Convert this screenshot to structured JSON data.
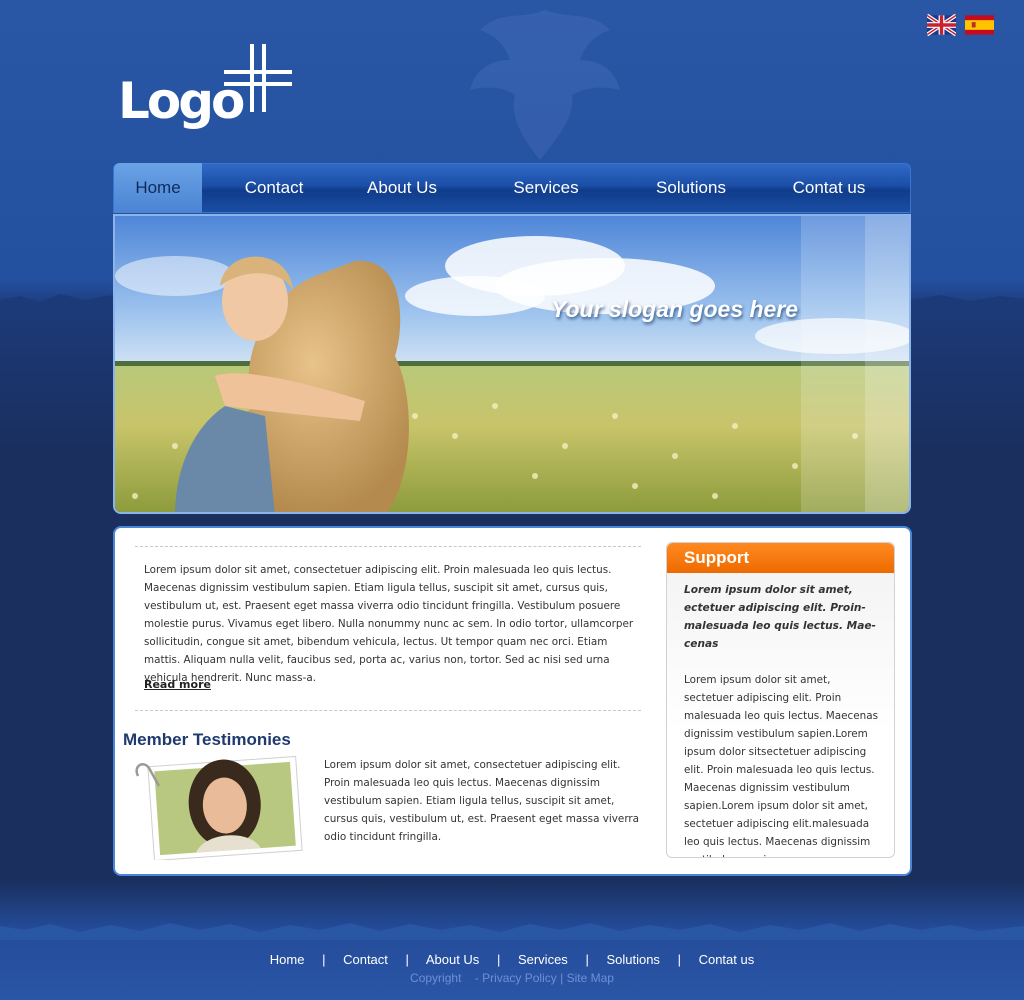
{
  "header": {
    "logo_text": "Logo",
    "flags": [
      {
        "icon": "uk-flag-icon",
        "language": "English"
      },
      {
        "icon": "spain-flag-icon",
        "language": "Spanish"
      }
    ]
  },
  "nav": {
    "items": [
      {
        "label": "Home",
        "active": true
      },
      {
        "label": "Contact"
      },
      {
        "label": "About Us"
      },
      {
        "label": "Services"
      },
      {
        "label": "Solutions"
      },
      {
        "label": "Contat us"
      }
    ]
  },
  "banner": {
    "slogan": "Your slogan goes here"
  },
  "main": {
    "intro_text": "Lorem ipsum dolor sit amet, consectetuer adipiscing elit. Proin malesuada leo quis lectus. Maecenas dignissim vestibulum sapien. Etiam ligula tellus, suscipit sit amet, cursus quis, vestibulum ut, est. Praesent eget massa viverra odio tincidunt fringilla. Vestibulum posuere molestie purus. Vivamus eget libero. Nulla nonummy nunc ac sem. In odio tortor, ullamcorper sollicitudin, congue sit amet, bibendum vehicula, lectus. Ut tempor quam nec orci. Etiam mattis. Aliquam nulla velit, faucibus sed, porta ac, varius non, tortor. Sed ac nisi sed urna vehicula hendrerit. Nunc mass-a.",
    "read_more": "Read more",
    "testimonies_title": "Member Testimonies",
    "testimony_text": "Lorem ipsum dolor sit amet, consectetuer adipiscing elit. Proin malesuada leo quis lectus. Maecenas dignissim vestibulum sapien. Etiam ligula tellus, suscipit sit amet, cursus quis, vestibulum ut, est. Praesent eget massa viverra odio tincidunt fringilla."
  },
  "support": {
    "title": "Support",
    "lead": "Lorem ipsum dolor sit amet, ectetuer adipiscing elit. Proin- malesuada leo quis lectus. Mae- cenas",
    "body": "Lorem ipsum dolor sit amet, sectetuer adipiscing elit. Proin malesuada leo quis lectus. Maecenas dignissim vestibulum sapien.Lorem ipsum dolor sitsectetuer adipiscing elit. Proin malesuada leo quis lectus. Maecenas dignissim vestibulum sapien.Lorem ipsum dolor sit amet, sectetuer adipiscing elit.malesuada leo quis lectus. Maecenas dignissim vestibulum sapien."
  },
  "footer": {
    "links": [
      "Home",
      "Contact",
      "About Us",
      "Services",
      "Solutions",
      "Contat us"
    ],
    "separator": "|",
    "copyright": "Copyright",
    "privacy": "- Privacy Policy",
    "copy_sep": "|",
    "sitemap": "Site Map"
  },
  "colors": {
    "accent_orange": "#ee6a00",
    "nav_blue": "#1b4ea6",
    "background_blue": "#2a56a6"
  }
}
